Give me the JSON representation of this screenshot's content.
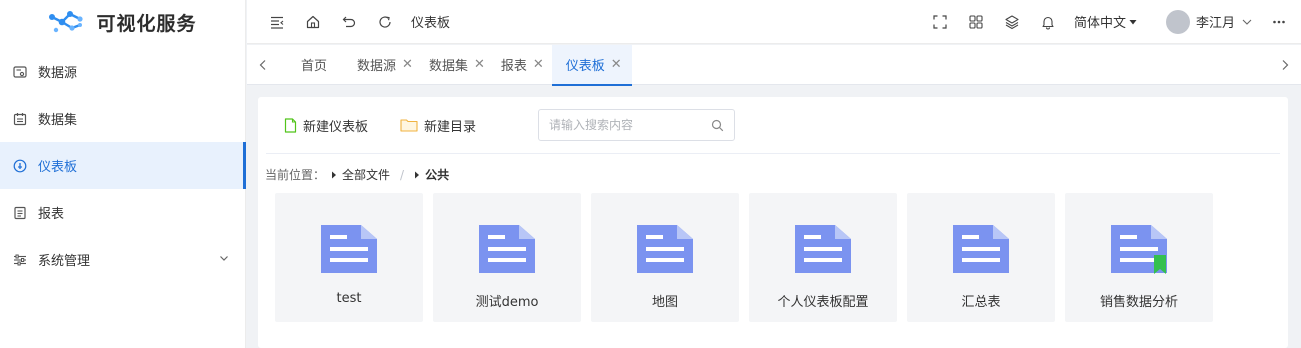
{
  "app": {
    "title": "可视化服务"
  },
  "sidebar": {
    "items": [
      {
        "label": "数据源",
        "icon": "datasource-icon",
        "active": false
      },
      {
        "label": "数据集",
        "icon": "dataset-icon",
        "active": false
      },
      {
        "label": "仪表板",
        "icon": "dashboard-icon",
        "active": true
      },
      {
        "label": "报表",
        "icon": "report-icon",
        "active": false
      },
      {
        "label": "系统管理",
        "icon": "settings-sliders-icon",
        "active": false,
        "expandable": true
      }
    ]
  },
  "header": {
    "breadcrumb": "仪表板",
    "language": "简体中文",
    "user_name": "李江月"
  },
  "tabs": [
    {
      "label": "首页",
      "closable": false,
      "active": false
    },
    {
      "label": "数据源",
      "closable": true,
      "active": false
    },
    {
      "label": "数据集",
      "closable": true,
      "active": false
    },
    {
      "label": "报表",
      "closable": true,
      "active": false
    },
    {
      "label": "仪表板",
      "closable": true,
      "active": true
    }
  ],
  "toolbar": {
    "new_dashboard_label": "新建仪表板",
    "new_folder_label": "新建目录",
    "search_placeholder": "请输入搜索内容"
  },
  "path": {
    "prefix": "当前位置：",
    "segments": [
      "全部文件",
      "公共"
    ],
    "separator": "/"
  },
  "files": [
    {
      "name": "test",
      "bookmarked": false
    },
    {
      "name": "测试demo",
      "bookmarked": false
    },
    {
      "name": "地图",
      "bookmarked": false
    },
    {
      "name": "个人仪表板配置",
      "bookmarked": false
    },
    {
      "name": "汇总表",
      "bookmarked": false
    },
    {
      "name": "销售数据分析",
      "bookmarked": true
    }
  ],
  "colors": {
    "accent": "#1f6fd6",
    "file_icon": "#7b93f0",
    "file_icon_fold": "#b8c6f7",
    "bookmark": "#34c04f",
    "new_dashboard_icon": "#52c41a",
    "new_folder_icon": "#f0b341"
  }
}
